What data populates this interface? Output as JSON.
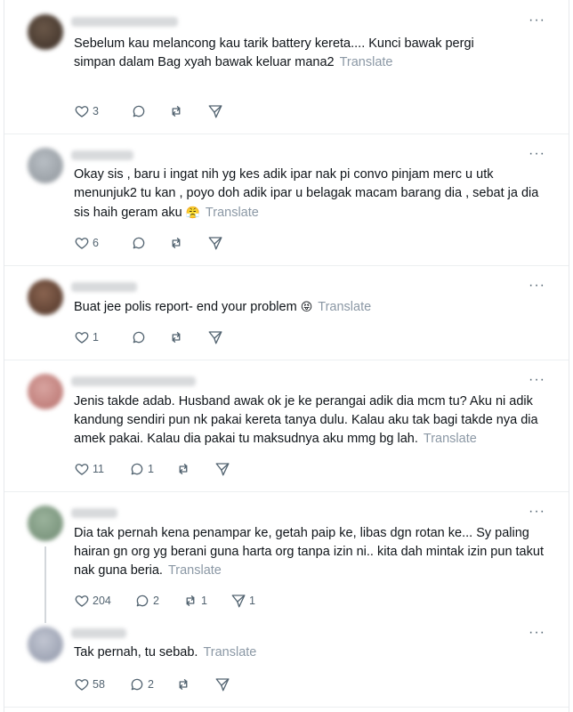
{
  "colors": {
    "text": "#0f1419",
    "muted": "#536471",
    "translate": "#8b98a5",
    "divider": "#eceff1"
  },
  "posts": [
    {
      "avatar_color": "#4d4036",
      "text": "Sebelum kau melancong kau tarik battery kereta.... Kunci bawak pergi simpan dalam Bag xyah bawak keluar mana2",
      "translate": "Translate",
      "likes": "3",
      "replies": "",
      "reposts": "",
      "shares": ""
    },
    {
      "avatar_color": "#9ea4ab",
      "text": "Okay sis , baru i ingat nih yg kes adik ipar nak pi convo pinjam merc u utk menunjuk2 tu kan , poyo doh adik ipar u belagak macam barang dia , sebat ja dia sis haih geram aku",
      "emoji": "😤",
      "translate": "Translate",
      "likes": "6",
      "replies": "",
      "reposts": "",
      "shares": ""
    },
    {
      "avatar_color": "#6b4a3a",
      "text": "Buat jee polis report- end your problem",
      "emoji": "😝",
      "translate": "Translate",
      "likes": "1",
      "replies": "",
      "reposts": "",
      "shares": ""
    },
    {
      "avatar_color": "#c98a86",
      "text": "Jenis takde adab. Husband awak ok je ke perangai adik dia mcm tu? Aku ni adik kandung sendiri pun nk pakai kereta tanya dulu. Kalau aku tak bagi takde nya dia amek pakai. Kalau dia pakai tu maksudnya aku mmg bg lah.",
      "translate": "Translate",
      "likes": "11",
      "replies": "1",
      "reposts": "",
      "shares": ""
    },
    {
      "avatar_color": "#86a189",
      "text": "Dia tak pernah kena penampar ke, getah paip ke, libas dgn rotan ke... Sy paling hairan gn org yg berani guna harta org tanpa izin ni.. kita dah mintak izin pun takut nak guna beria.",
      "translate": "Translate",
      "likes": "204",
      "replies": "2",
      "reposts": "1",
      "shares": "1"
    },
    {
      "avatar_color": "#aab0c0",
      "text": "Tak pernah, tu sebab.",
      "translate": "Translate",
      "likes": "58",
      "replies": "2",
      "reposts": "",
      "shares": ""
    }
  ]
}
